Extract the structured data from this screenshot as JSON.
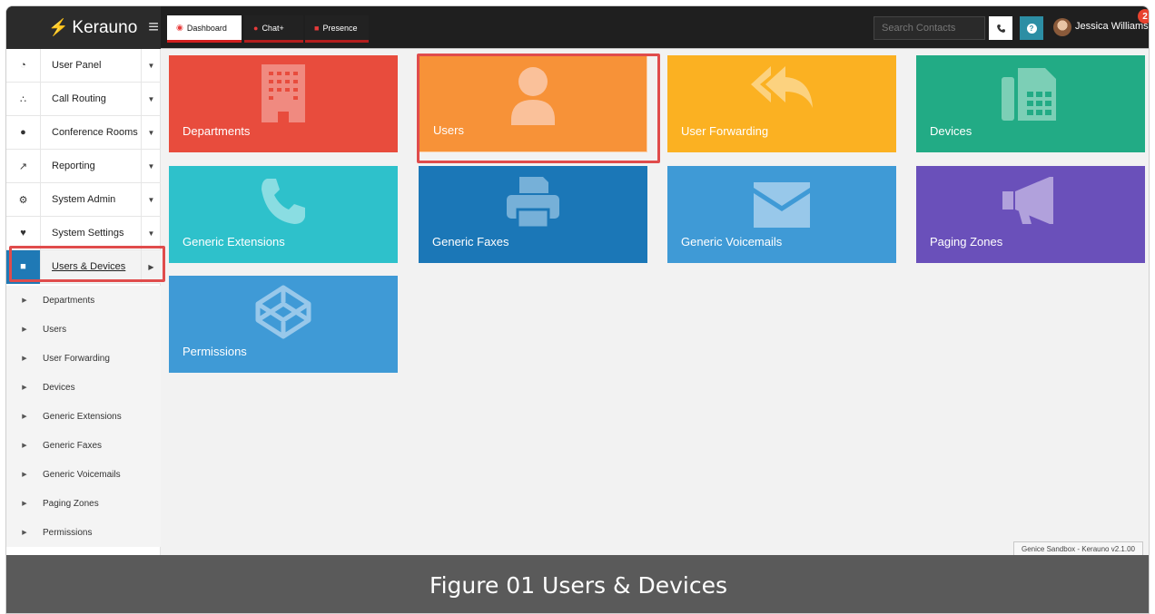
{
  "app": {
    "brand": "Kerauno",
    "notification_count": "2"
  },
  "tabs": [
    {
      "label": "Dashboard"
    },
    {
      "label": "Chat+"
    },
    {
      "label": "Presence"
    }
  ],
  "header": {
    "search_placeholder": "Search Contacts",
    "user_name": "Jessica Williams"
  },
  "sidebar": {
    "items": [
      {
        "label": "User Panel",
        "icon": "dashboard-icon"
      },
      {
        "label": "Call Routing",
        "icon": "sitemap-icon"
      },
      {
        "label": "Conference Rooms",
        "icon": "comments-icon"
      },
      {
        "label": "Reporting",
        "icon": "line-chart-icon"
      },
      {
        "label": "System Admin",
        "icon": "gears-icon"
      },
      {
        "label": "System Settings",
        "icon": "heartbeat-icon"
      },
      {
        "label": "Users & Devices",
        "icon": "users-icon"
      }
    ],
    "subitems": [
      {
        "label": "Departments"
      },
      {
        "label": "Users"
      },
      {
        "label": "User Forwarding"
      },
      {
        "label": "Devices"
      },
      {
        "label": "Generic Extensions"
      },
      {
        "label": "Generic Faxes"
      },
      {
        "label": "Generic Voicemails"
      },
      {
        "label": "Paging Zones"
      },
      {
        "label": "Permissions"
      }
    ]
  },
  "tiles": [
    {
      "label": "Departments",
      "color": "#e84c3d",
      "icon": "building-icon"
    },
    {
      "label": "Users",
      "color": "#f79238",
      "icon": "user-icon"
    },
    {
      "label": "User Forwarding",
      "color": "#fbb122",
      "icon": "reply-all-icon"
    },
    {
      "label": "Devices",
      "color": "#22ab85",
      "icon": "fax-phone-icon"
    },
    {
      "label": "Generic Extensions",
      "color": "#2ec1cb",
      "icon": "phone-icon"
    },
    {
      "label": "Generic Faxes",
      "color": "#1b77b7",
      "icon": "printer-icon"
    },
    {
      "label": "Generic Voicemails",
      "color": "#3f9ad6",
      "icon": "envelope-icon"
    },
    {
      "label": "Paging Zones",
      "color": "#6a50ba",
      "icon": "bullhorn-icon"
    },
    {
      "label": "Permissions",
      "color": "#3f9ad6",
      "icon": "codepen-icon"
    }
  ],
  "footer": {
    "version": "Genice Sandbox - Kerauno v2.1.00"
  },
  "caption": "Figure 01 Users & Devices"
}
